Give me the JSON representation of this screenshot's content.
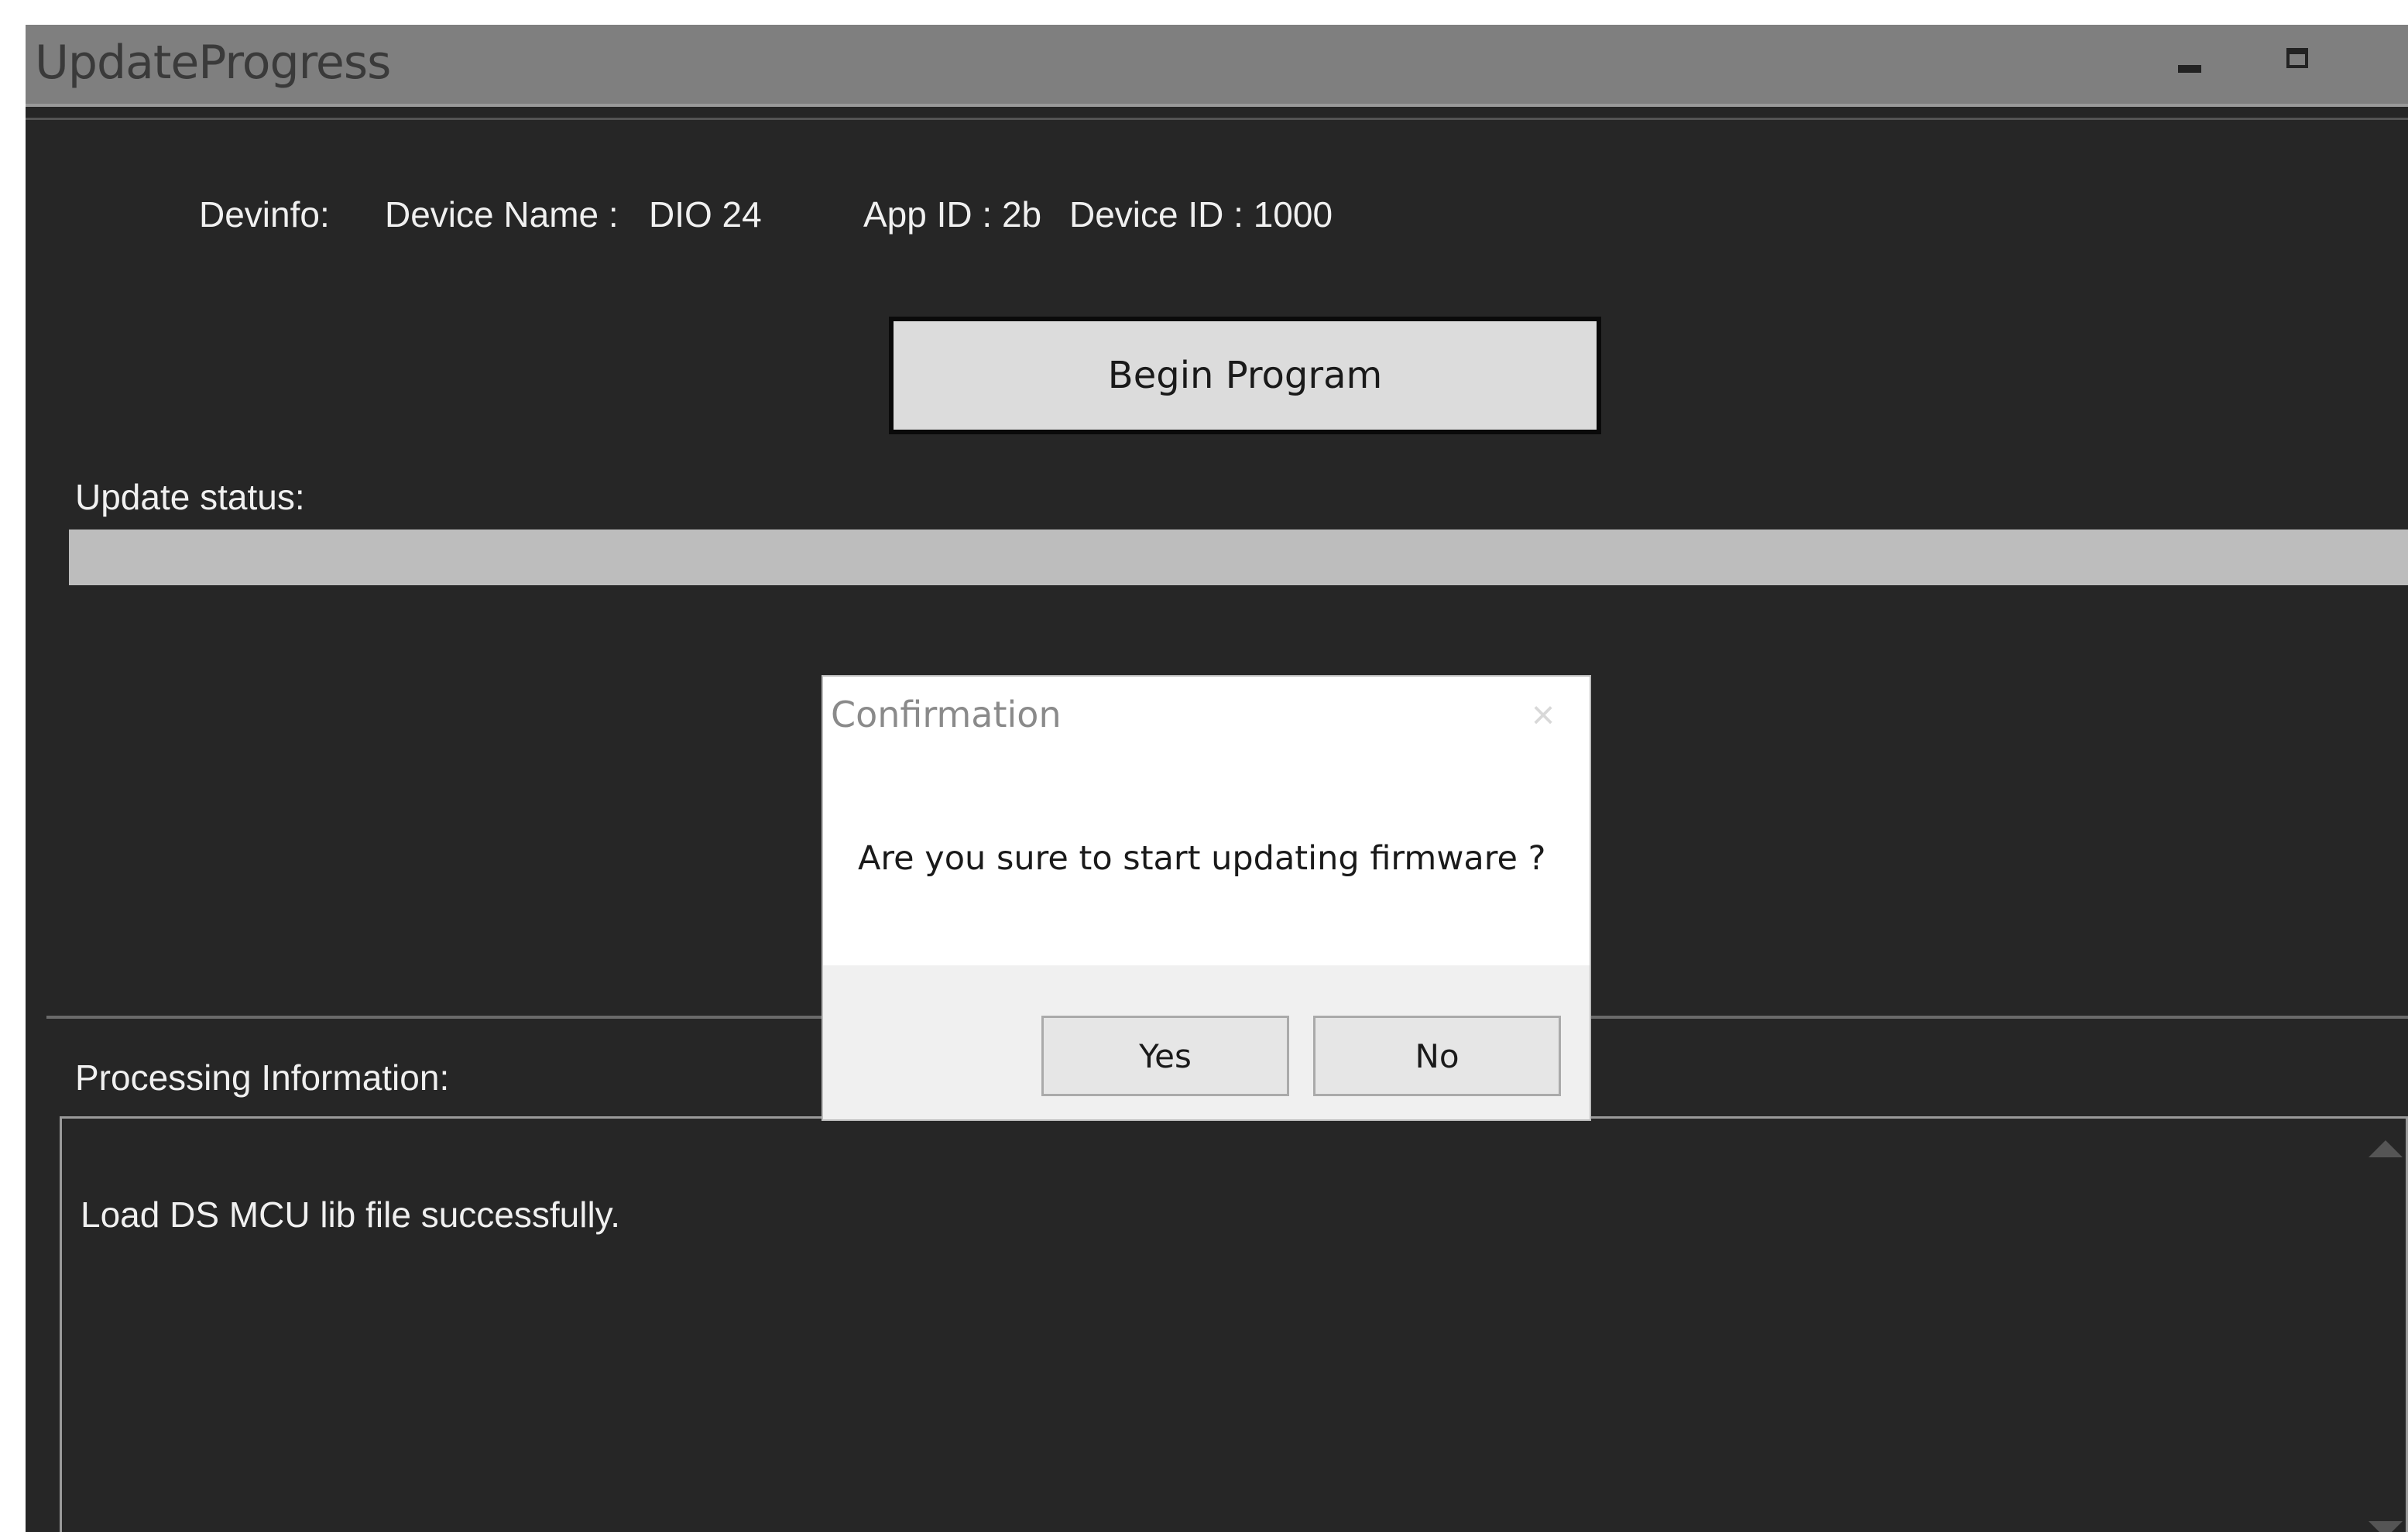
{
  "window": {
    "title": "UpdateProgress"
  },
  "devinfo": {
    "label": "Devinfo:",
    "device_name_label": "Device Name :",
    "device_name_value": "DIO 24",
    "app_id_text": "App ID : 2b",
    "device_id_text": "Device ID : 1000"
  },
  "actions": {
    "begin_program_label": "Begin Program"
  },
  "update_status": {
    "label": "Update status:",
    "progress_percent": 0
  },
  "processing": {
    "label": "Processing Information:",
    "log_text": "Load DS MCU lib file successfully."
  },
  "dialog": {
    "title": "Confirmation",
    "message": "Are you sure to start updating firmware ?",
    "yes_label": "Yes",
    "no_label": "No"
  },
  "icons": {
    "minimize": "minimize-icon",
    "maximize": "maximize-icon",
    "close": "close-icon",
    "scroll_up": "scroll-up-icon",
    "scroll_down": "scroll-down-icon"
  },
  "colors": {
    "window_bg": "#262626",
    "titlebar_bg": "#7f7f7f",
    "progress_track": "#bdbdbd",
    "button_bg": "#dcdcdc"
  }
}
